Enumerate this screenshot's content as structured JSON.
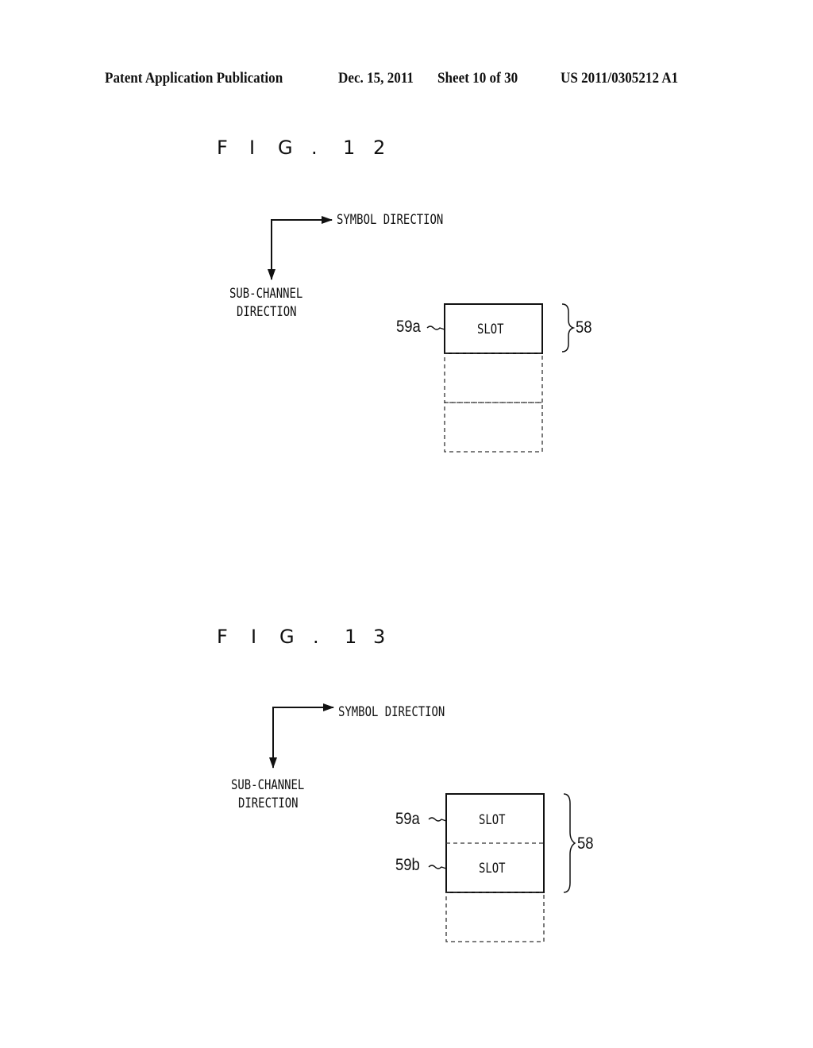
{
  "header": {
    "publication": "Patent Application Publication",
    "date": "Dec. 15, 2011",
    "sheet": "Sheet 10 of 30",
    "number": "US 2011/0305212 A1"
  },
  "figures": [
    {
      "title_chars": [
        "F",
        "I",
        "G",
        ".",
        "1",
        "2"
      ],
      "axis": {
        "horizontal": "SYMBOL DIRECTION",
        "vertical_line1": "SUB-CHANNEL",
        "vertical_line2": "DIRECTION"
      },
      "group_ref": "58",
      "slots": [
        {
          "ref": "59a",
          "label": "SLOT",
          "state": "allocated"
        },
        {
          "ref": "",
          "label": "",
          "state": "unallocated"
        },
        {
          "ref": "",
          "label": "",
          "state": "unallocated"
        }
      ]
    },
    {
      "title_chars": [
        "F",
        "I",
        "G",
        ".",
        "1",
        "3"
      ],
      "axis": {
        "horizontal": "SYMBOL DIRECTION",
        "vertical_line1": "SUB-CHANNEL",
        "vertical_line2": "DIRECTION"
      },
      "group_ref": "58",
      "slots": [
        {
          "ref": "59a",
          "label": "SLOT",
          "state": "allocated"
        },
        {
          "ref": "59b",
          "label": "SLOT",
          "state": "allocated"
        },
        {
          "ref": "",
          "label": "",
          "state": "unallocated"
        }
      ]
    }
  ]
}
